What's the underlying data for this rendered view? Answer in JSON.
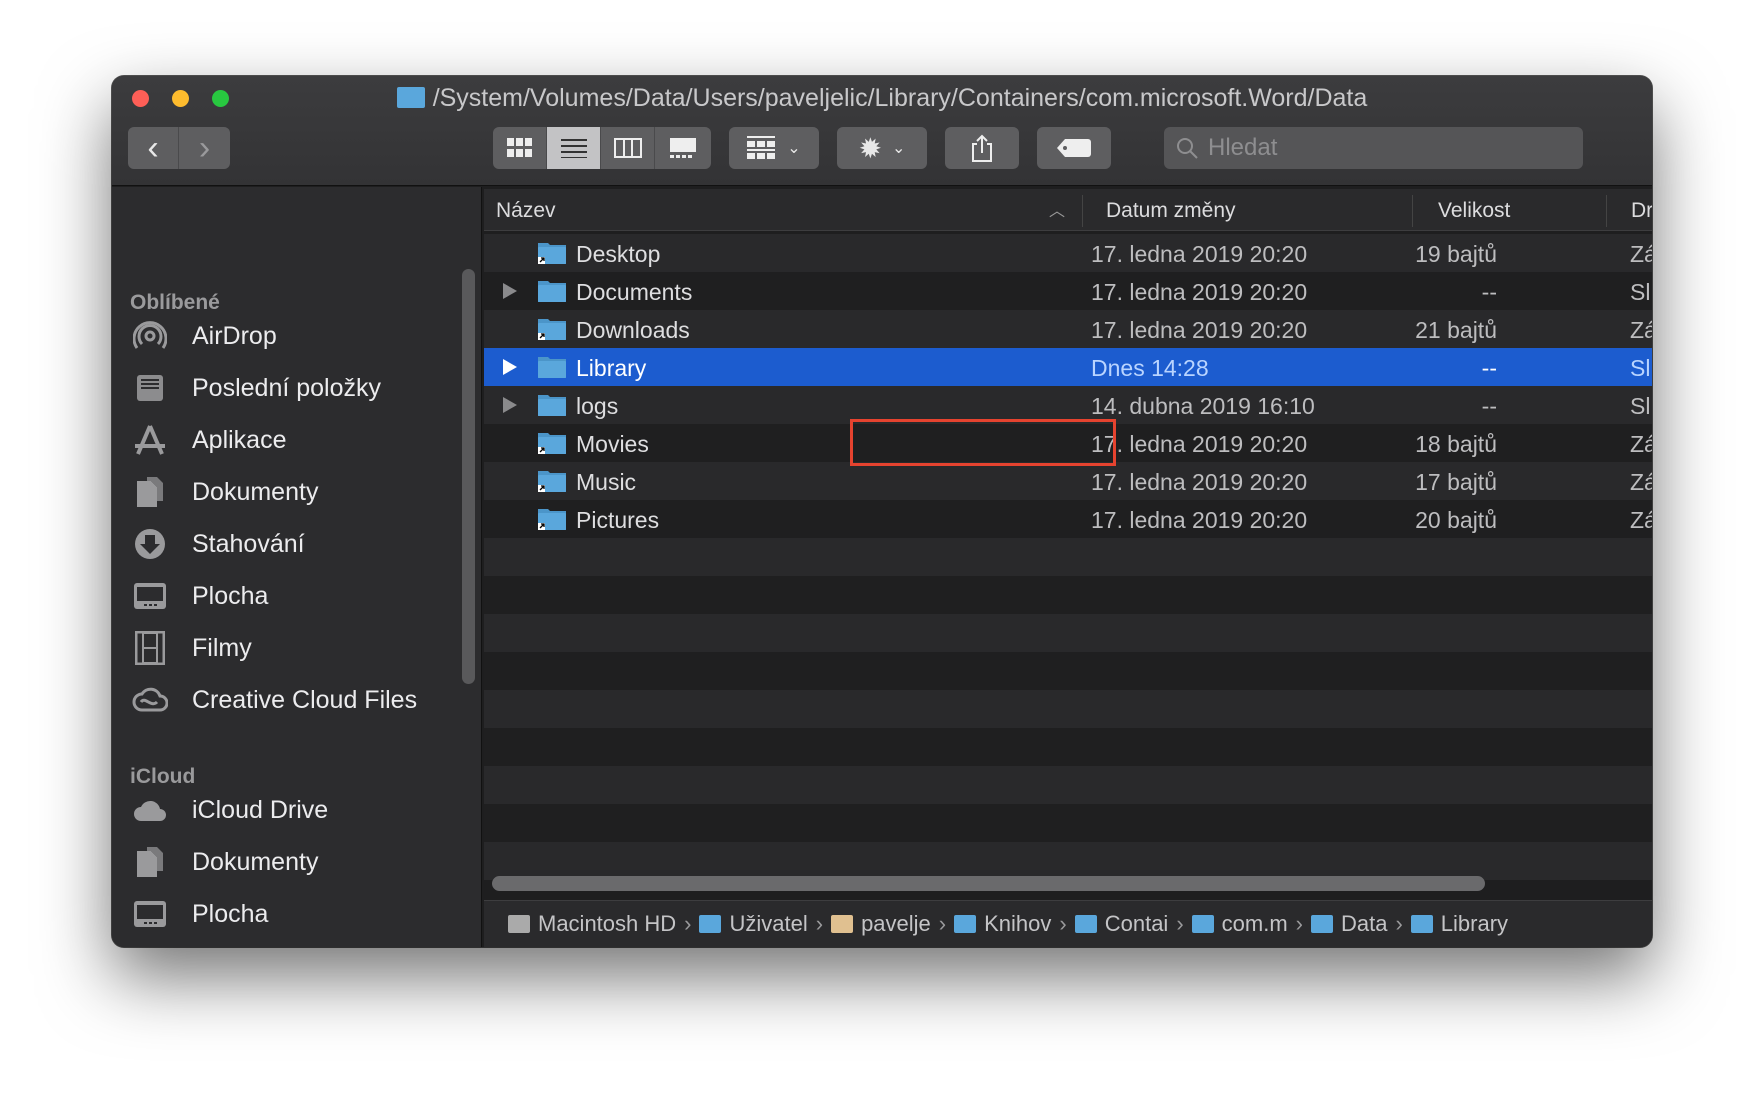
{
  "window": {
    "title": "/System/Volumes/Data/Users/paveljelic/Library/Containers/com.microsoft.Word/Data"
  },
  "toolbar": {
    "back": "‹",
    "forward": "›",
    "search_placeholder": "Hledat"
  },
  "sidebar": {
    "sections": [
      {
        "title": "Oblíbené",
        "items": [
          {
            "label": "AirDrop",
            "icon": "airdrop-icon"
          },
          {
            "label": "Poslední položky",
            "icon": "recents-icon"
          },
          {
            "label": "Aplikace",
            "icon": "applications-icon"
          },
          {
            "label": "Dokumenty",
            "icon": "documents-icon"
          },
          {
            "label": "Stahování",
            "icon": "downloads-icon"
          },
          {
            "label": "Plocha",
            "icon": "desktop-icon"
          },
          {
            "label": "Filmy",
            "icon": "movies-icon"
          },
          {
            "label": "Creative Cloud Files",
            "icon": "creative-cloud-icon"
          }
        ]
      },
      {
        "title": "iCloud",
        "items": [
          {
            "label": "iCloud Drive",
            "icon": "icloud-icon"
          },
          {
            "label": "Dokumenty",
            "icon": "documents-icon"
          },
          {
            "label": "Plocha",
            "icon": "desktop-icon"
          }
        ]
      },
      {
        "title": "Místa",
        "items": [
          {
            "label": "Macintosh HD",
            "icon": "hard-drive-icon"
          }
        ]
      }
    ]
  },
  "columns": {
    "name": "Název",
    "date": "Datum změny",
    "size": "Velikost",
    "kind": "Dr"
  },
  "files": [
    {
      "name": "Desktop",
      "date": "17. ledna 2019 20:20",
      "size": "19 bajtů",
      "kind": "Zá",
      "expandable": false,
      "alias": true
    },
    {
      "name": "Documents",
      "date": "17. ledna 2019 20:20",
      "size": "--",
      "kind": "Sl",
      "expandable": true,
      "alias": false
    },
    {
      "name": "Downloads",
      "date": "17. ledna 2019 20:20",
      "size": "21 bajtů",
      "kind": "Zá",
      "expandable": false,
      "alias": true
    },
    {
      "name": "Library",
      "date": "Dnes 14:28",
      "size": "--",
      "kind": "Sl",
      "expandable": true,
      "alias": false,
      "selected": true
    },
    {
      "name": "logs",
      "date": "14. dubna 2019 16:10",
      "size": "--",
      "kind": "Sl",
      "expandable": true,
      "alias": false
    },
    {
      "name": "Movies",
      "date": "17. ledna 2019 20:20",
      "size": "18 bajtů",
      "kind": "Zá",
      "expandable": false,
      "alias": true
    },
    {
      "name": "Music",
      "date": "17. ledna 2019 20:20",
      "size": "17 bajtů",
      "kind": "Zá",
      "expandable": false,
      "alias": true
    },
    {
      "name": "Pictures",
      "date": "17. ledna 2019 20:20",
      "size": "20 bajtů",
      "kind": "Zá",
      "expandable": false,
      "alias": true
    }
  ],
  "pathbar": [
    "Macintosh HD",
    "Uživatel",
    "pavelje",
    "Knihov",
    "Contai",
    "com.m",
    "Data",
    "Library"
  ],
  "colors": {
    "selection": "#1c5ccf",
    "highlight_box": "#e5432f",
    "folder": "#5aa7dc"
  }
}
